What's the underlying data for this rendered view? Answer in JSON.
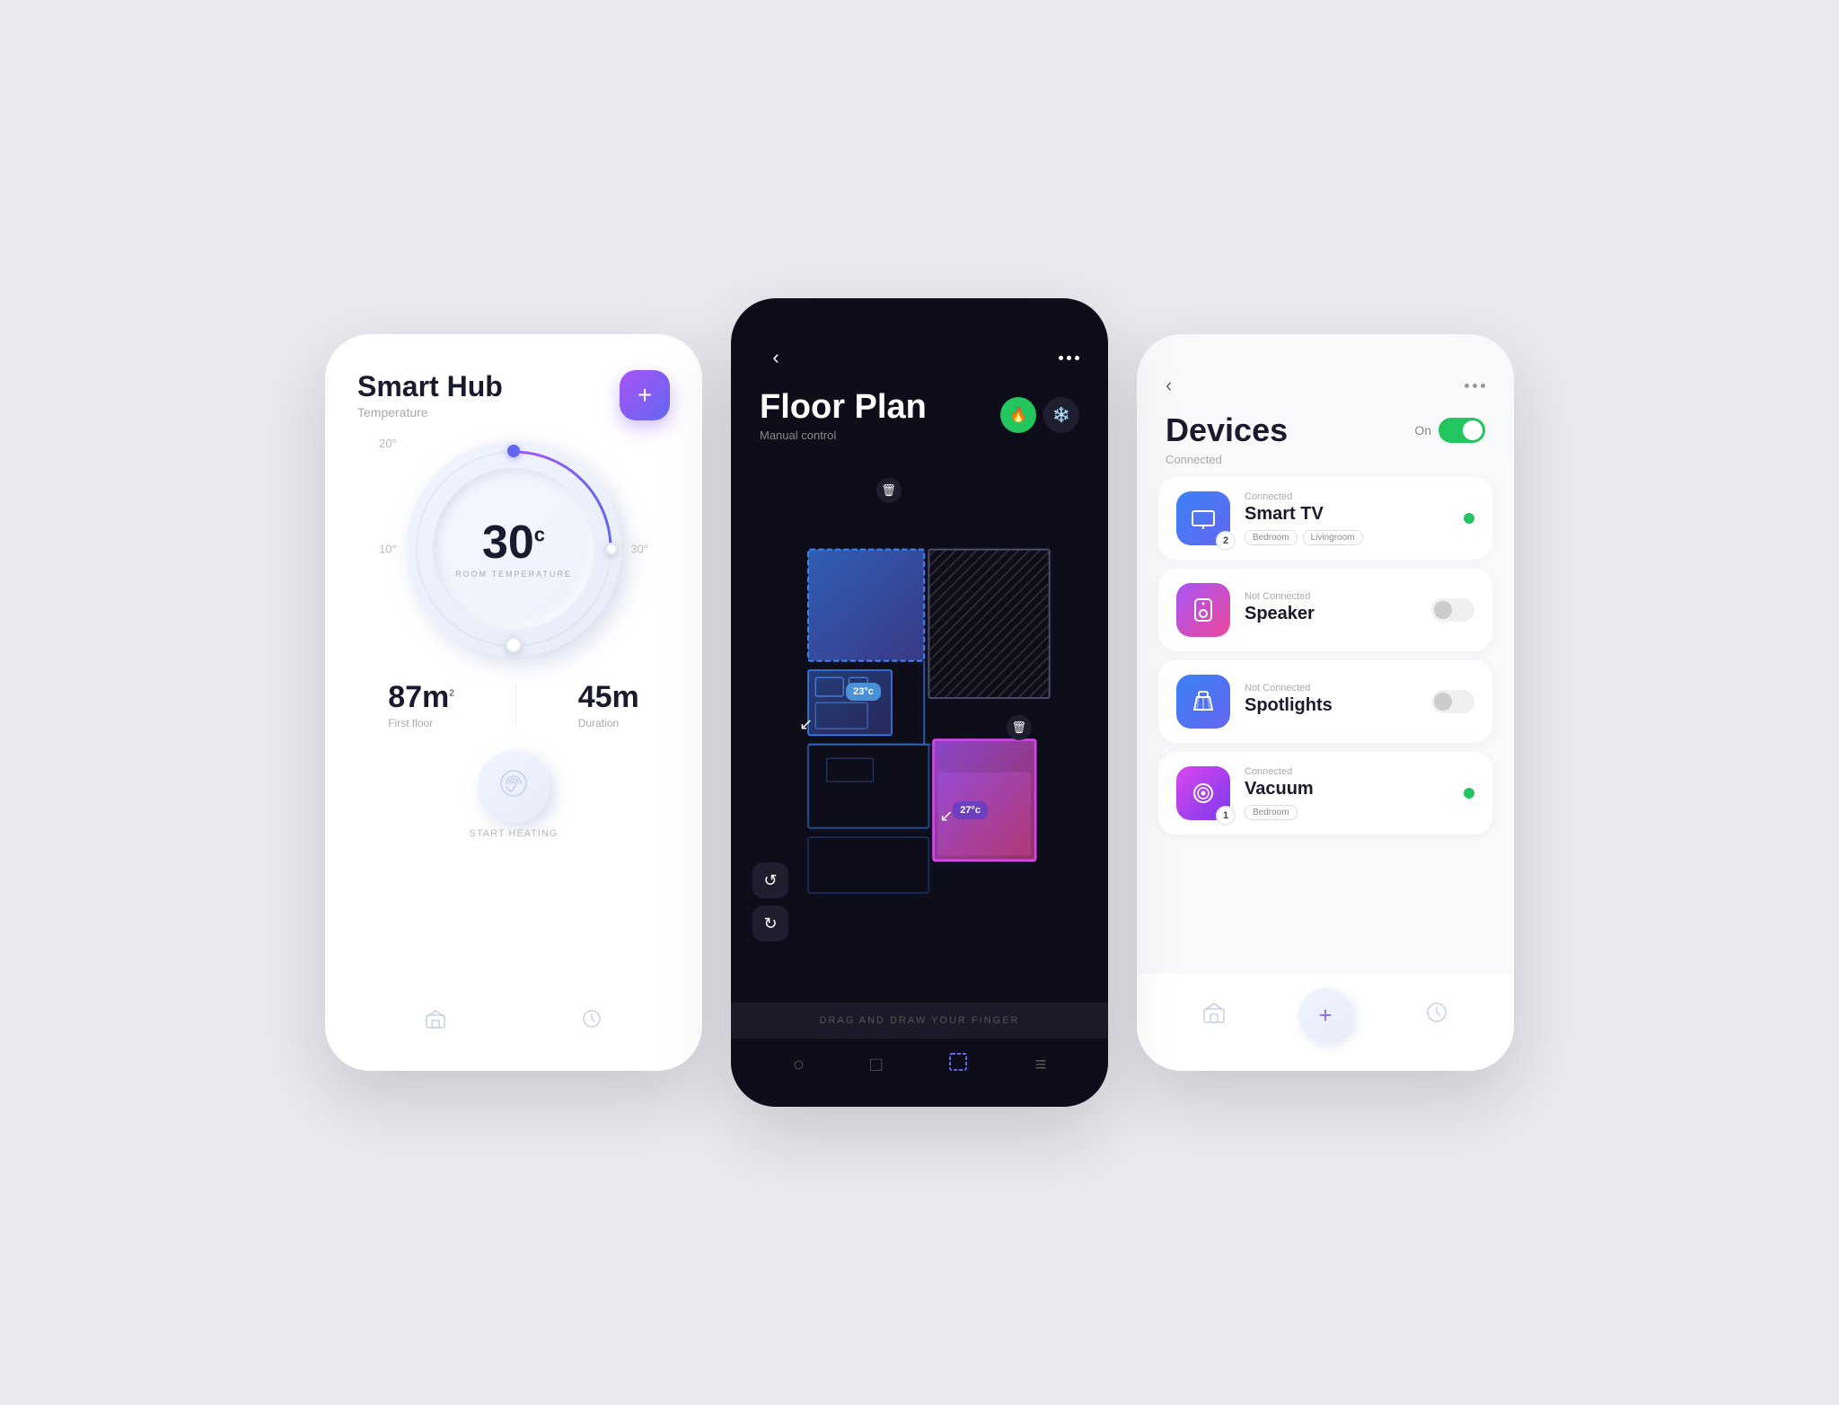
{
  "screen1": {
    "title": "Smart Hub",
    "subtitle": "Temperature",
    "add_btn_label": "+",
    "temp_value": "30",
    "temp_unit": "c",
    "temp_label": "ROOM TEMPERATURE",
    "label_20": "20°",
    "label_10": "10°",
    "label_30": "30°",
    "area_value": "87m",
    "area_sup": "2",
    "area_label": "First floor",
    "duration_value": "45m",
    "duration_label": "Duration",
    "start_label": "START HEATING"
  },
  "screen2": {
    "title": "Floor Plan",
    "subtitle": "Manual control",
    "temp1": "23°c",
    "temp2": "27°c",
    "drag_hint": "DRAG AND DRAW YOUR FINGER"
  },
  "screen3": {
    "title": "Devices",
    "connected_label": "Connected",
    "toggle_label": "On",
    "devices": [
      {
        "id": "smart-tv",
        "status": "Connected",
        "name": "Smart TV",
        "tags": [
          "Bedroom",
          "Livingroom"
        ],
        "connected": true,
        "badge": "2",
        "icon": "tv"
      },
      {
        "id": "speaker",
        "status": "Not Connected",
        "name": "Speaker",
        "tags": [],
        "connected": false,
        "badge": null,
        "icon": "speaker"
      },
      {
        "id": "spotlights",
        "status": "Not Connected",
        "name": "Spotlights",
        "tags": [],
        "connected": false,
        "badge": null,
        "icon": "spotlight"
      },
      {
        "id": "vacuum",
        "status": "Connected",
        "name": "Vacuum",
        "tags": [
          "Bedroom"
        ],
        "connected": true,
        "badge": "1",
        "icon": "vacuum"
      }
    ],
    "nav_add": "+"
  }
}
